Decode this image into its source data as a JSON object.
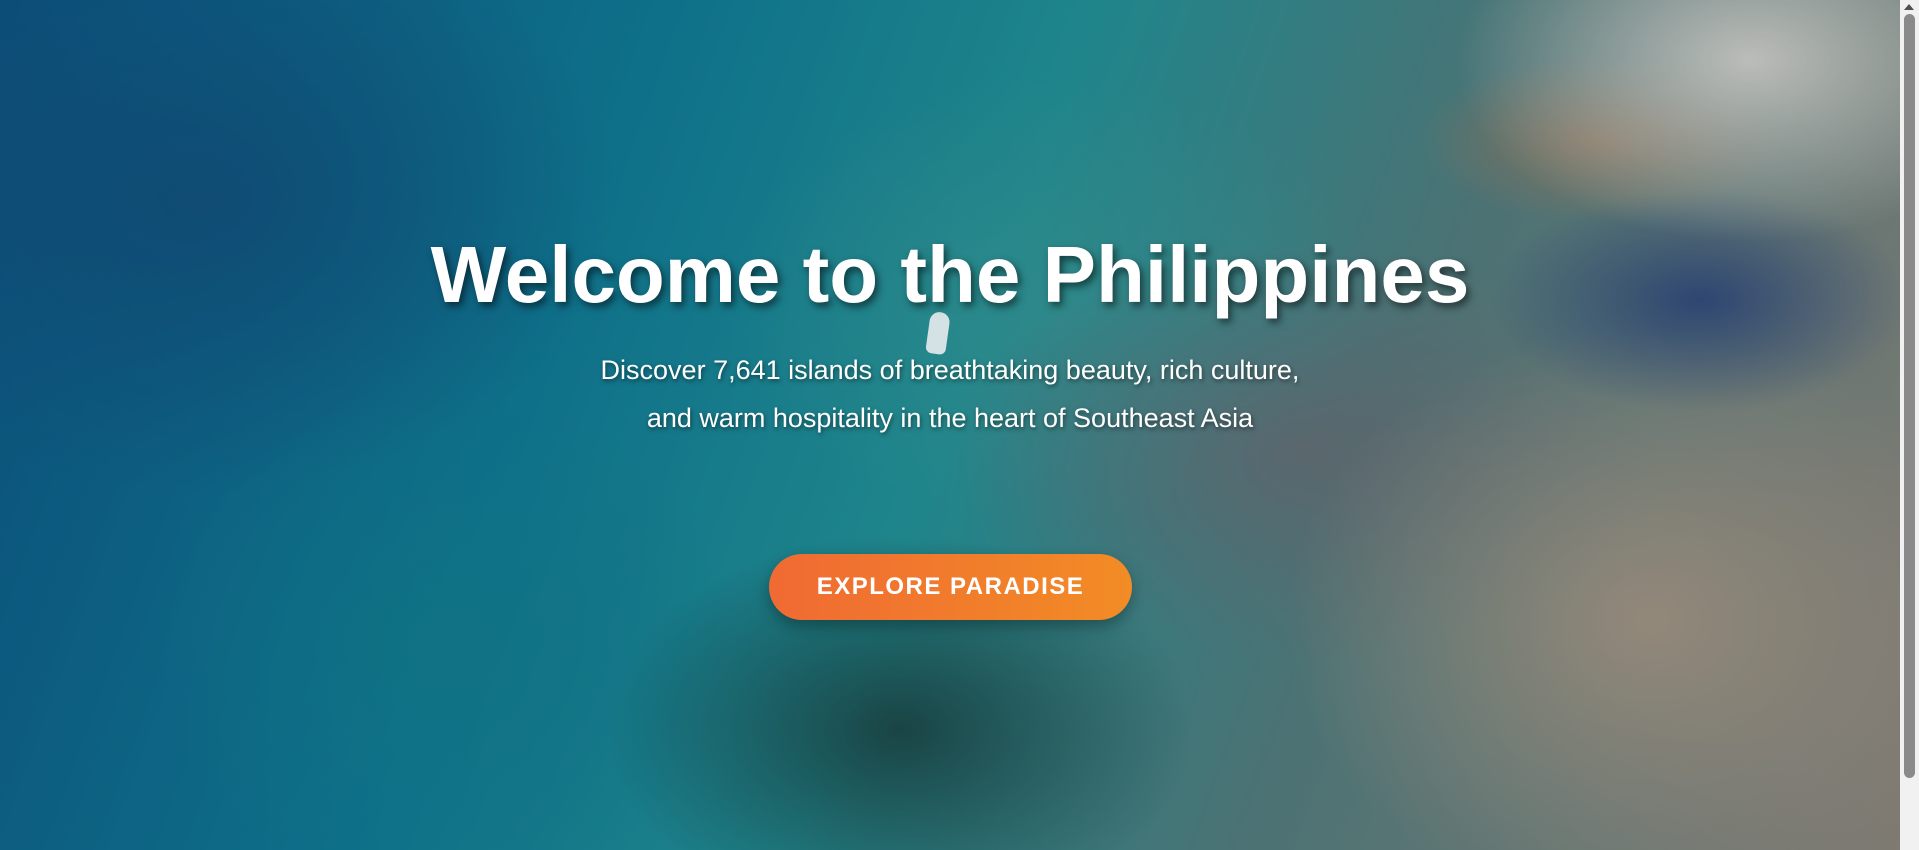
{
  "hero": {
    "title": "Welcome to the Philippines",
    "subtitle": "Discover 7,641 islands of breathtaking beauty, rich culture, and warm hospitality in the heart of Southeast Asia",
    "cta_label": "EXPLORE PARADISE"
  },
  "colors": {
    "accent_start": "#f06a33",
    "accent_end": "#f28c25",
    "text": "#ffffff"
  }
}
